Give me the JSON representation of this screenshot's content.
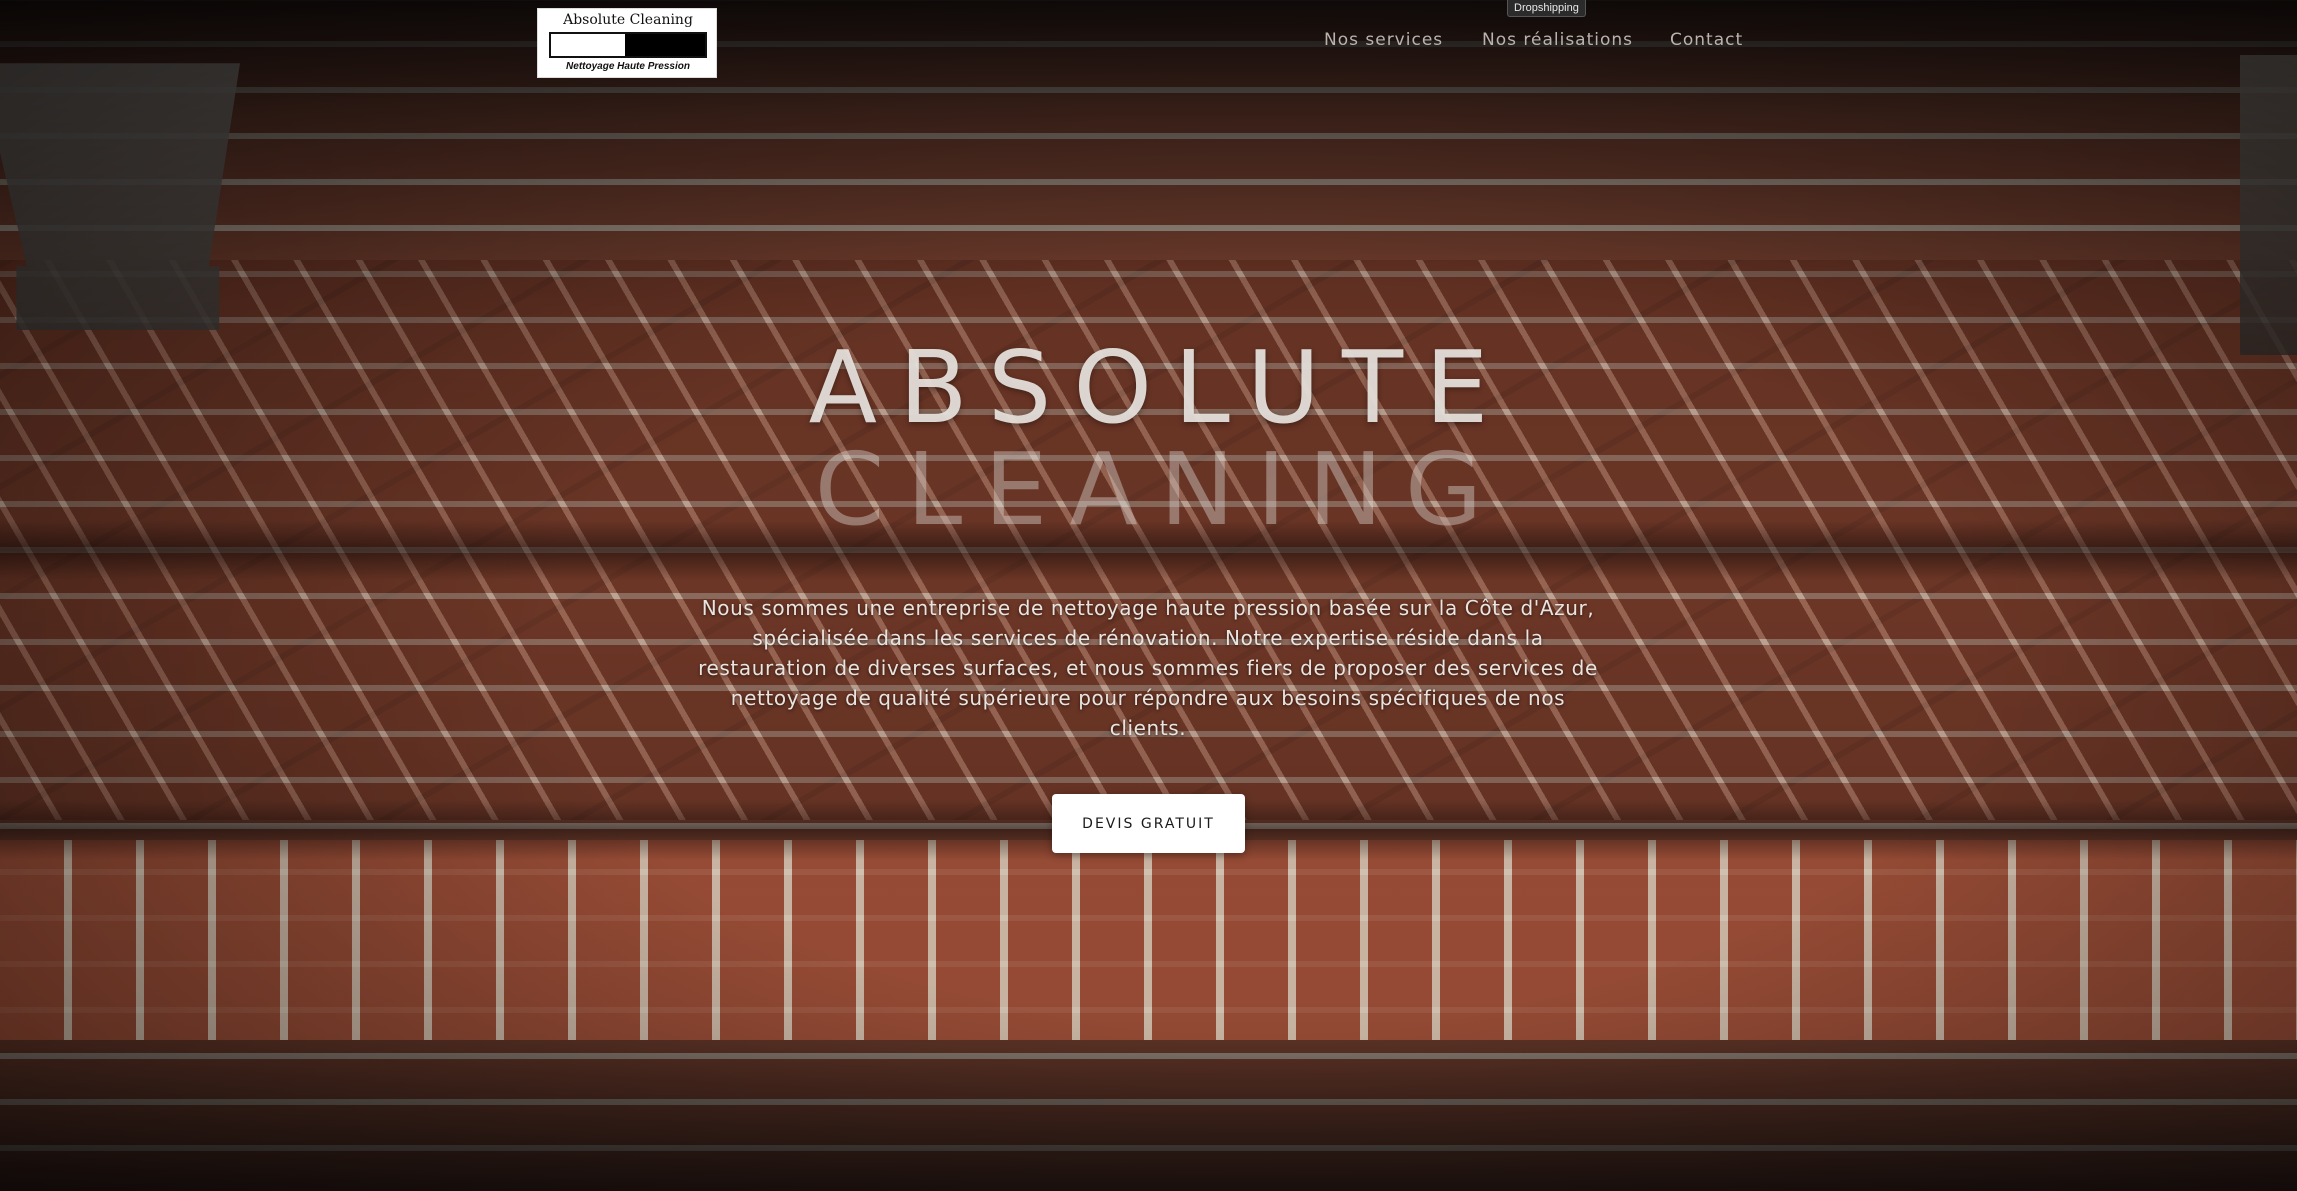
{
  "logo": {
    "title": "Absolute Cleaning",
    "subtitle": "Nettoyage Haute Pression"
  },
  "badge": "Dropshipping",
  "nav": {
    "items": [
      {
        "label": "Nos services"
      },
      {
        "label": "Nos réalisations"
      },
      {
        "label": "Contact"
      }
    ]
  },
  "hero": {
    "title_line1": "ABSOLUTE",
    "title_line2": "CLEANING",
    "description": "Nous sommes une entreprise de nettoyage haute pression basée sur la Côte d'Azur, spécialisée dans les services de rénovation. Notre expertise réside dans la restauration de diverses surfaces, et nous sommes fiers de proposer des services de nettoyage de qualité supérieure pour répondre aux besoins spécifiques de nos clients.",
    "cta_label": "DEVIS GRATUIT",
    "background": "brick-steps-photo"
  }
}
